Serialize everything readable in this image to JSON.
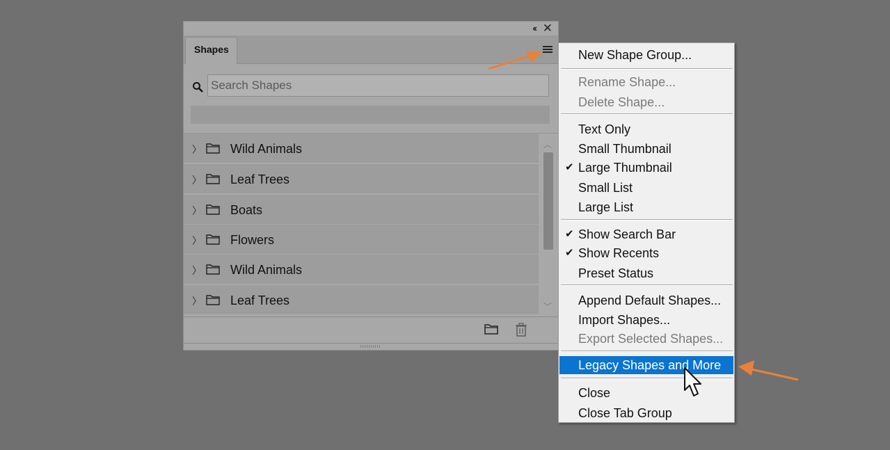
{
  "panel": {
    "tab_label": "Shapes",
    "collapse_glyph": "‹‹",
    "close_glyph": "✕",
    "search_placeholder": "Search Shapes",
    "items": [
      {
        "label": "Wild Animals"
      },
      {
        "label": "Leaf Trees"
      },
      {
        "label": "Boats"
      },
      {
        "label": "Flowers"
      },
      {
        "label": "Wild Animals"
      },
      {
        "label": "Leaf Trees"
      }
    ]
  },
  "menu": {
    "items": [
      {
        "label": "New Shape Group...",
        "disabled": false,
        "checked": false
      },
      {
        "label": "Rename Shape...",
        "disabled": true,
        "checked": false
      },
      {
        "label": "Delete Shape...",
        "disabled": true,
        "checked": false
      },
      {
        "label": "Text Only",
        "disabled": false,
        "checked": false
      },
      {
        "label": "Small Thumbnail",
        "disabled": false,
        "checked": false
      },
      {
        "label": "Large Thumbnail",
        "disabled": false,
        "checked": true
      },
      {
        "label": "Small List",
        "disabled": false,
        "checked": false
      },
      {
        "label": "Large List",
        "disabled": false,
        "checked": false
      },
      {
        "label": "Show Search Bar",
        "disabled": false,
        "checked": true
      },
      {
        "label": "Show Recents",
        "disabled": false,
        "checked": true
      },
      {
        "label": "Preset Status",
        "disabled": false,
        "checked": false
      },
      {
        "label": "Append Default Shapes...",
        "disabled": false,
        "checked": false
      },
      {
        "label": "Import Shapes...",
        "disabled": false,
        "checked": false
      },
      {
        "label": "Export Selected Shapes...",
        "disabled": true,
        "checked": false
      },
      {
        "label": "Legacy Shapes and More",
        "disabled": false,
        "checked": false,
        "highlighted": true
      },
      {
        "label": "Close",
        "disabled": false,
        "checked": false
      },
      {
        "label": "Close Tab Group",
        "disabled": false,
        "checked": false
      }
    ],
    "check_glyph": "✔"
  },
  "colors": {
    "background": "#707070",
    "highlight": "#0a74d0",
    "annotation_arrow": "#e8823a"
  }
}
